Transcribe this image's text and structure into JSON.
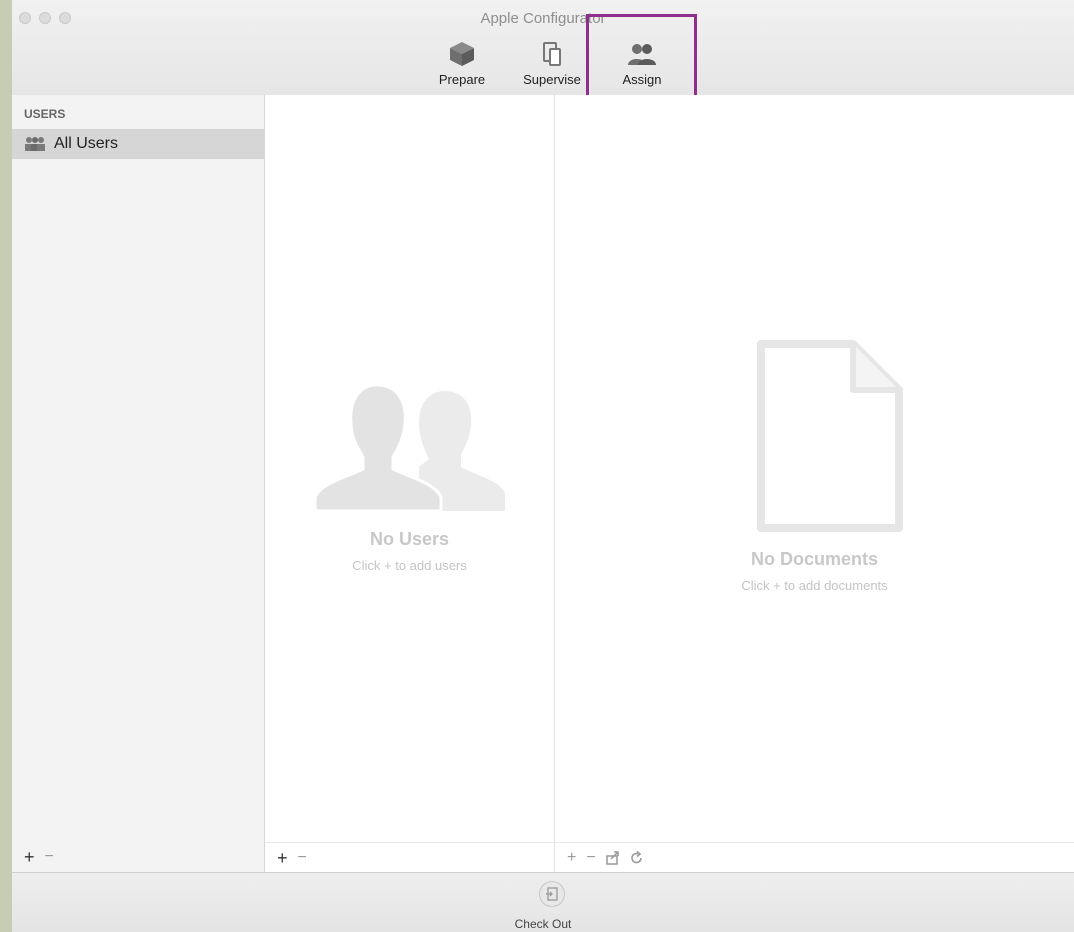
{
  "window": {
    "title": "Apple Configurator"
  },
  "toolbar": {
    "tabs": [
      {
        "label": "Prepare",
        "icon": "box-icon"
      },
      {
        "label": "Supervise",
        "icon": "devices-icon"
      },
      {
        "label": "Assign",
        "icon": "users-icon"
      }
    ],
    "highlight_color": "#8e2f8e"
  },
  "sidebar": {
    "section_header": "USERS",
    "items": [
      {
        "label": "All Users",
        "icon": "group-icon",
        "selected": true
      }
    ],
    "add_label": "+",
    "remove_label": "−"
  },
  "users_pane": {
    "empty_title": "No Users",
    "empty_subtitle": "Click + to add users",
    "add_label": "+",
    "remove_label": "−"
  },
  "documents_pane": {
    "empty_title": "No Documents",
    "empty_subtitle": "Click + to add documents",
    "add_label": "+",
    "remove_label": "−"
  },
  "footer": {
    "checkout_label": "Check Out"
  }
}
